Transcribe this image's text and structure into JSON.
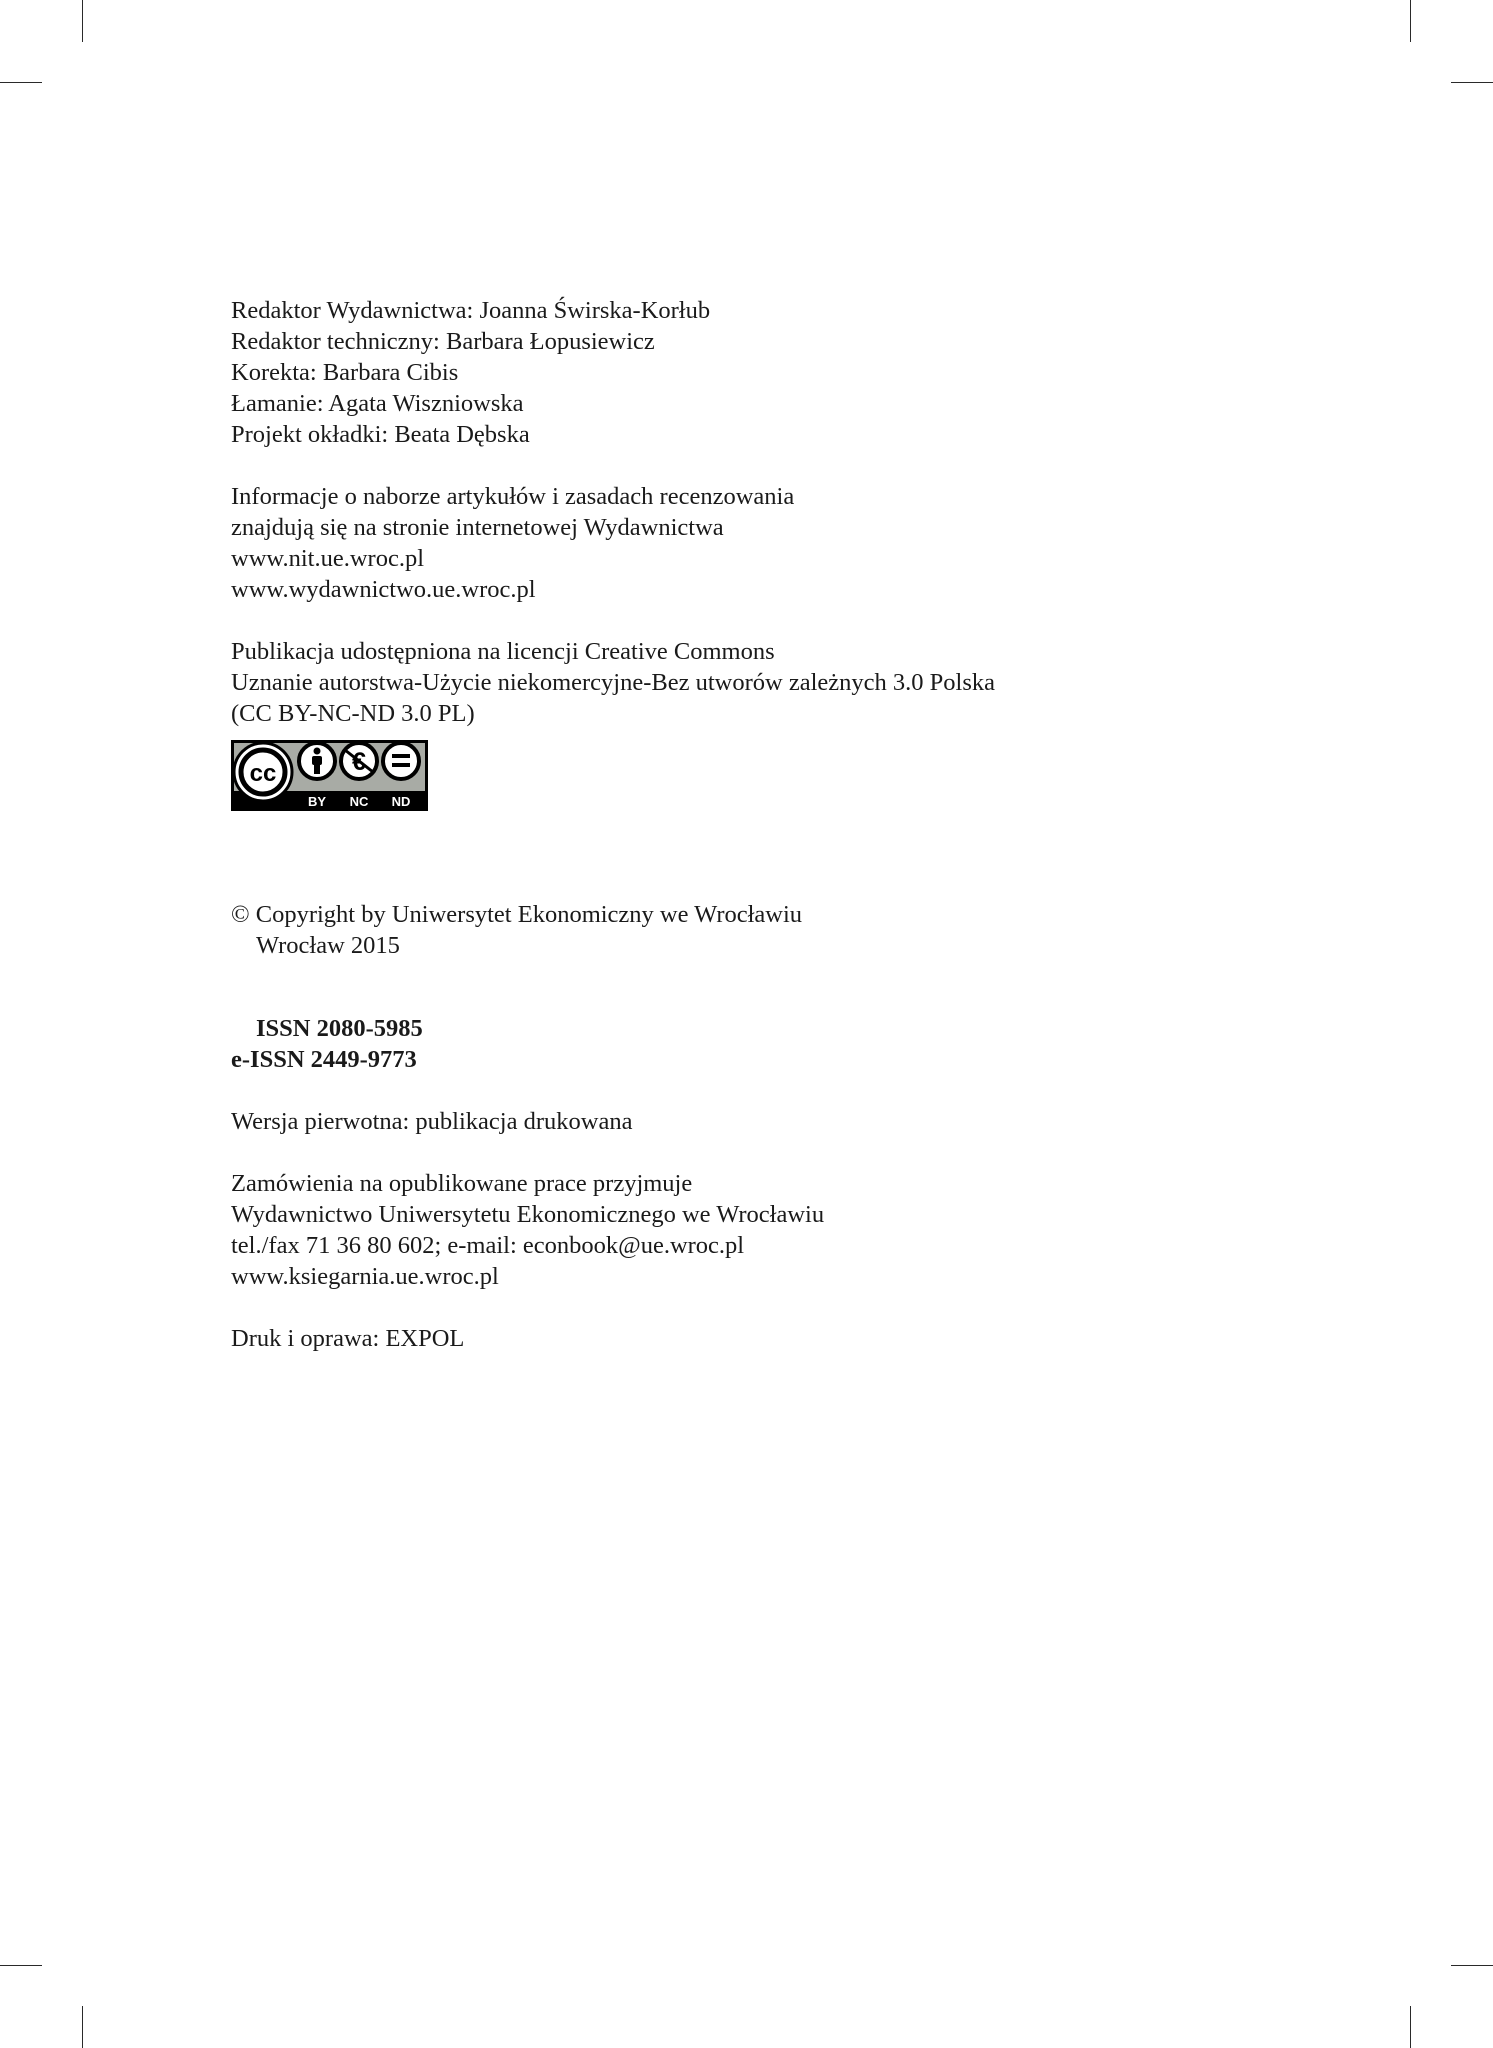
{
  "credits": [
    "Redaktor Wydawnictwa: Joanna Świrska-Korłub",
    "Redaktor techniczny: Barbara Łopusiewicz",
    "Korekta: Barbara Cibis",
    "Łamanie: Agata Wiszniowska",
    "Projekt okładki: Beata Dębska"
  ],
  "info": [
    "Informacje o naborze artykułów i zasadach recenzowania",
    "znajdują się na stronie internetowej Wydawnictwa",
    "www.nit.ue.wroc.pl",
    "www.wydawnictwo.ue.wroc.pl"
  ],
  "license": [
    "Publikacja udostępniona na licencji Creative Commons",
    "Uznanie autorstwa-Użycie niekomercyjne-Bez utworów zależnych 3.0 Polska",
    "(CC BY-NC-ND 3.0 PL)"
  ],
  "cc_badge": {
    "icon": "cc-by-nc-nd-badge",
    "labels": [
      "BY",
      "NC",
      "ND"
    ],
    "colors": {
      "background": "#000000",
      "circle_fill": "#ffffff",
      "grey_panel": "#a8aba5"
    }
  },
  "copyright": {
    "line1": "© Copyright by Uniwersytet Ekonomiczny we Wrocławiu",
    "line2": "Wrocław 2015"
  },
  "issn": {
    "print": "ISSN 2080-5985",
    "electronic": "e-ISSN 2449-9773"
  },
  "version": "Wersja pierwotna: publikacja drukowana",
  "orders": [
    "Zamówienia na opublikowane prace przyjmuje",
    "Wydawnictwo Uniwersytetu Ekonomicznego we Wrocławiu",
    "tel./fax 71 36 80 602; e-mail: econbook@ue.wroc.pl",
    "www.ksiegarnia.ue.wroc.pl"
  ],
  "printing": "Druk i oprawa: EXPOL"
}
